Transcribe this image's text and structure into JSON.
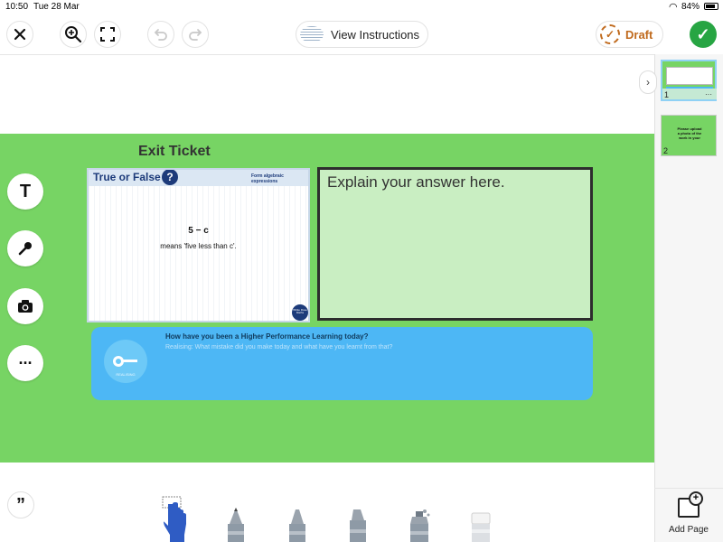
{
  "status_bar": {
    "time": "10:50",
    "date": "Tue 28 Mar",
    "battery": "84%"
  },
  "toolbar": {
    "close_icon": "close-icon",
    "zoom_icon": "zoom-in-icon",
    "fullscreen_icon": "fullscreen-icon",
    "undo_icon": "undo-icon",
    "redo_icon": "redo-icon",
    "view_instructions_label": "View Instructions",
    "draft_label": "Draft",
    "submit_icon": "checkmark-icon"
  },
  "canvas": {
    "heading": "Exit Ticket",
    "true_false_card": {
      "title": "True or False",
      "subtitle": "Form algebraic expressions",
      "expression": "5 − c",
      "statement": "means 'five less than c'.",
      "logo_text": "White Rose Maths"
    },
    "explain_box": {
      "prompt": "Explain your answer here."
    },
    "hpl_box": {
      "question": "How have you been a Higher Performance Learning today?",
      "realising_text": "Realising: What mistake did you make today and what have you learnt from that?",
      "icon_caption": "REALISING"
    }
  },
  "side_tools": [
    {
      "name": "text-tool",
      "glyph": "T"
    },
    {
      "name": "microphone-tool",
      "glyph": "🎤"
    },
    {
      "name": "camera-tool",
      "glyph": "📷"
    },
    {
      "name": "more-tool",
      "glyph": "···"
    }
  ],
  "right_panel": {
    "pages": [
      {
        "number": "1",
        "more": "···"
      },
      {
        "number": "2",
        "text": "Please upload a photo of the work in your"
      }
    ],
    "add_page_label": "Add Page"
  },
  "bottom_tools": [
    "hand-tool",
    "pen-tool",
    "marker-tool",
    "highlighter-tool",
    "spray-tool",
    "eraser-tool"
  ],
  "colors": {
    "canvas_green": "#77d464",
    "hpl_blue": "#4db7f5",
    "explain_fill": "#c9eec2",
    "submit_green": "#27a543",
    "draft_orange": "#c06a1d"
  }
}
